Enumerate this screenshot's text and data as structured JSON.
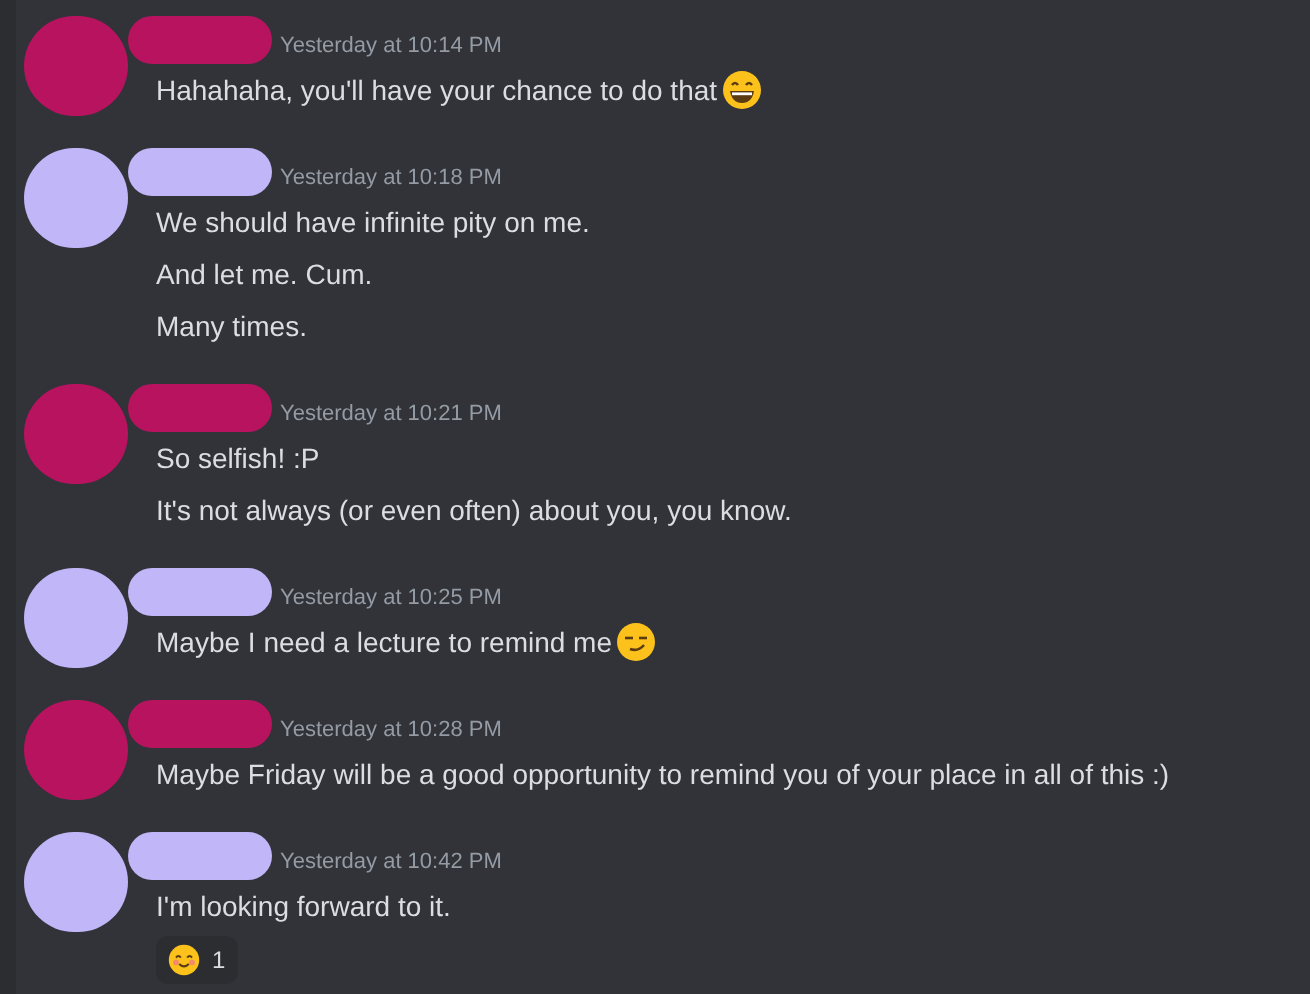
{
  "messages": [
    {
      "color": "#b8135f",
      "timestamp": "Yesterday at 10:14 PM",
      "lines": [
        {
          "text": "Hahahaha, you'll have your chance to do that",
          "emoji": {
            "kind": "grin"
          }
        }
      ]
    },
    {
      "color": "#c0b6f8",
      "timestamp": "Yesterday at 10:18 PM",
      "lines": [
        {
          "text": "We should have infinite pity on me."
        },
        {
          "text": "And let me. Cum."
        },
        {
          "text": "Many times."
        }
      ]
    },
    {
      "color": "#b8135f",
      "timestamp": "Yesterday at 10:21 PM",
      "lines": [
        {
          "text": "So selfish! :P"
        },
        {
          "text": "It's not always (or even often) about you, you know."
        }
      ]
    },
    {
      "color": "#c0b6f8",
      "timestamp": "Yesterday at 10:25 PM",
      "lines": [
        {
          "text": "Maybe I need a lecture to remind me",
          "emoji": {
            "kind": "smirk"
          }
        }
      ]
    },
    {
      "color": "#b8135f",
      "timestamp": "Yesterday at 10:28 PM",
      "lines": [
        {
          "text": "Maybe Friday will be a good opportunity to remind you of your place in all of this :)"
        }
      ]
    },
    {
      "color": "#c0b6f8",
      "timestamp": "Yesterday at 10:42 PM",
      "lines": [
        {
          "text": "I'm looking forward to it."
        }
      ],
      "reaction": {
        "emoji": {
          "kind": "blush"
        },
        "count": "1"
      }
    }
  ]
}
